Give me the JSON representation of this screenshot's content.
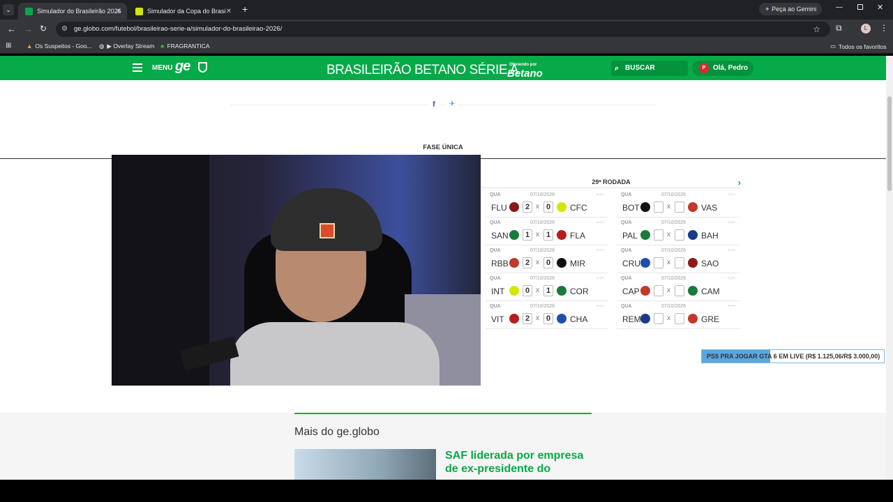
{
  "browser": {
    "tabs": [
      {
        "title": "Simulador do Brasileirão 2026",
        "active": true
      },
      {
        "title": "Simulador da Copa do Brasil 20",
        "active": false
      }
    ],
    "gemini_label": "Peça ao Gemini",
    "url": "ge.globo.com/futebol/brasileirao-serie-a/simulador-do-brasileirao-2026/",
    "profile_initial": "L",
    "bookmarks": [
      "Os Suspeitos - Goo...",
      "▶ Overlay Stream",
      "FRAGRANTICA"
    ],
    "all_bookmarks": "Todos os favoritos"
  },
  "header": {
    "menu_label": "MENU",
    "logo": "ge",
    "title": "BRASILEIRÃO BETANO SÉRIE A",
    "sponsor_small": "Oferecido por",
    "sponsor": "Betano",
    "search_label": "BUSCAR",
    "user_greeting": "Olá, Pedro",
    "user_initial": "P"
  },
  "phase_label": "FASE ÚNICA",
  "rodada": "29ª RODADA",
  "matches": [
    {
      "day": "QUA",
      "date": "07/10/2026",
      "time": "--:--",
      "home": "FLU",
      "away": "CFC",
      "home_score": "2",
      "away_score": "0"
    },
    {
      "day": "QUA",
      "date": "07/10/2026",
      "time": "--:--",
      "home": "SAN",
      "away": "FLA",
      "home_score": "1",
      "away_score": "1"
    },
    {
      "day": "QUA",
      "date": "07/10/2026",
      "time": "--:--",
      "home": "RBB",
      "away": "MIR",
      "home_score": "2",
      "away_score": "0"
    },
    {
      "day": "QUA",
      "date": "07/10/2026",
      "time": "--:--",
      "home": "INT",
      "away": "COR",
      "home_score": "0",
      "away_score": "1"
    },
    {
      "day": "QUA",
      "date": "07/10/2026",
      "time": "--:--",
      "home": "VIT",
      "away": "CHA",
      "home_score": "2",
      "away_score": "0"
    },
    {
      "day": "QUA",
      "date": "07/10/2026",
      "time": "--:--",
      "home": "BOT",
      "away": "VAS",
      "home_score": "",
      "away_score": ""
    },
    {
      "day": "QUA",
      "date": "07/10/2026",
      "time": "--:--",
      "home": "PAL",
      "away": "BAH",
      "home_score": "",
      "away_score": ""
    },
    {
      "day": "QUA",
      "date": "07/10/2026",
      "time": "--:--",
      "home": "CRU",
      "away": "SAO",
      "home_score": "",
      "away_score": ""
    },
    {
      "day": "QUA",
      "date": "07/10/2026",
      "time": "--:--",
      "home": "CAP",
      "away": "CAM",
      "home_score": "",
      "away_score": ""
    },
    {
      "day": "QUA",
      "date": "07/10/2026",
      "time": "--:--",
      "home": "REM",
      "away": "GRE",
      "home_score": "",
      "away_score": ""
    }
  ],
  "vs": "x",
  "live_banner": "PS5 PRA JOGAR GTA 6 EM LIVE (R$ 1.125,06/R$ 3.000,00)",
  "live_progress": 0.375,
  "mais": {
    "title": "Mais do ge.globo",
    "news_headline": "SAF liderada por empresa de ex-presidente do"
  },
  "colors": {
    "brand_green": "#06aa48",
    "progress_blue": "#5aa7e0"
  }
}
